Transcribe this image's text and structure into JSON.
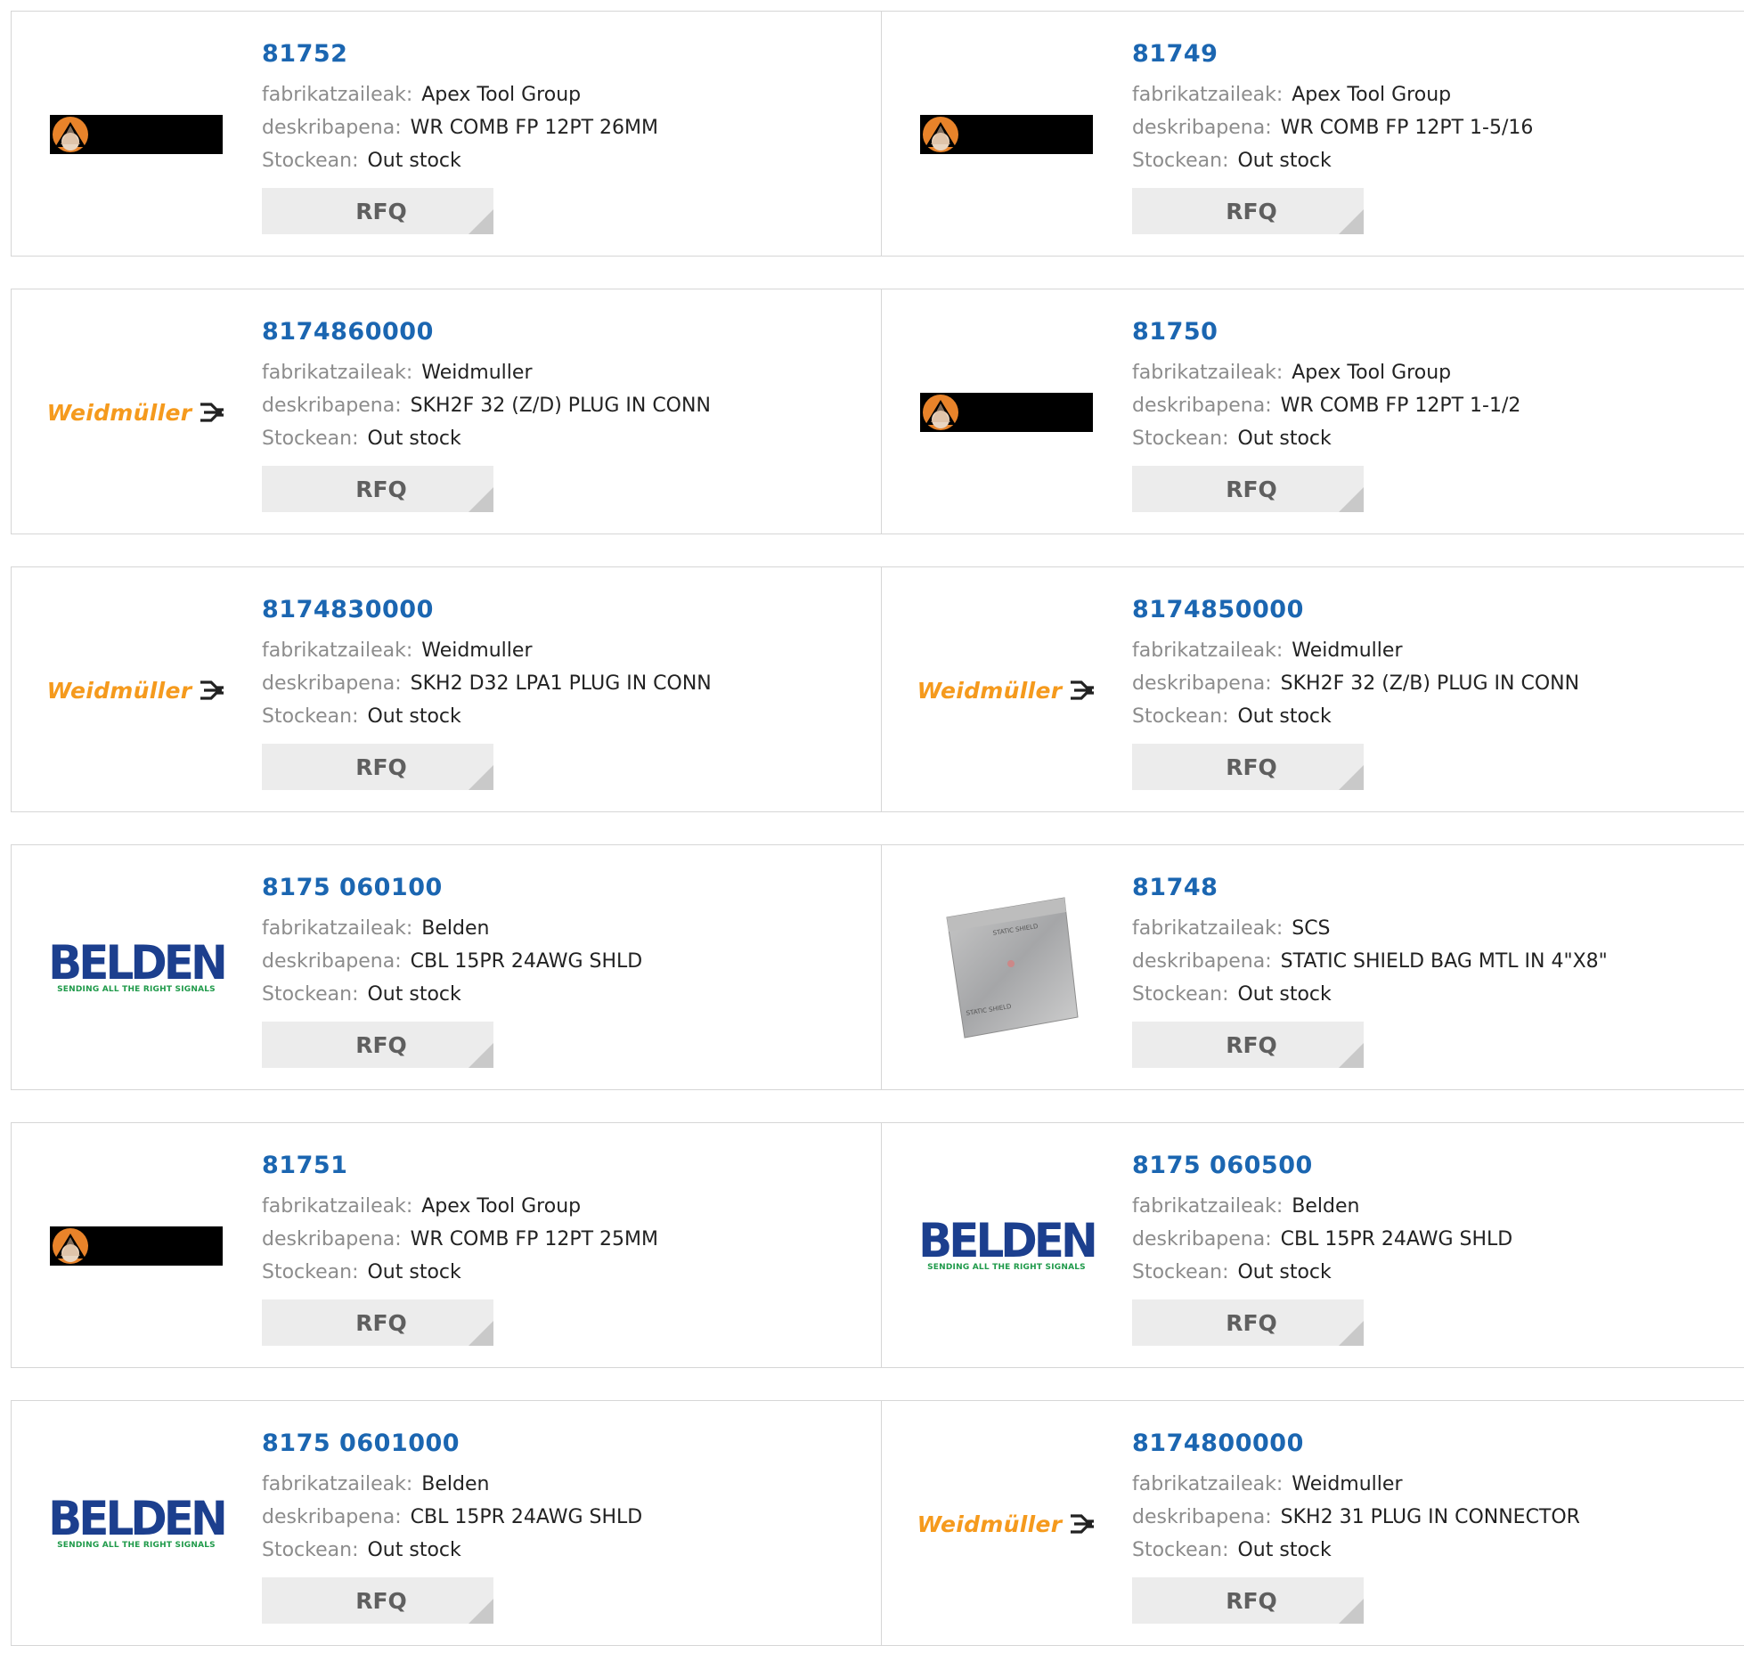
{
  "labels": {
    "manufacturer": "fabrikatzaileak:",
    "description": "deskribapena:",
    "stock": "Stockean:",
    "rfq": "RFQ"
  },
  "products": [
    {
      "part": "81752",
      "manufacturer": "Apex Tool Group",
      "description": "WR COMB FP 12PT 26MM",
      "stock": "Out stock",
      "logo": "apex"
    },
    {
      "part": "81749",
      "manufacturer": "Apex Tool Group",
      "description": "WR COMB FP 12PT 1-5/16",
      "stock": "Out stock",
      "logo": "apex"
    },
    {
      "part": "8174860000",
      "manufacturer": "Weidmuller",
      "description": "SKH2F 32 (Z/D) PLUG IN CONN",
      "stock": "Out stock",
      "logo": "weidmuller"
    },
    {
      "part": "81750",
      "manufacturer": "Apex Tool Group",
      "description": "WR COMB FP 12PT 1-1/2",
      "stock": "Out stock",
      "logo": "apex"
    },
    {
      "part": "8174830000",
      "manufacturer": "Weidmuller",
      "description": "SKH2 D32 LPA1 PLUG IN CONN",
      "stock": "Out stock",
      "logo": "weidmuller"
    },
    {
      "part": "8174850000",
      "manufacturer": "Weidmuller",
      "description": "SKH2F 32 (Z/B) PLUG IN CONN",
      "stock": "Out stock",
      "logo": "weidmuller"
    },
    {
      "part": "8175 060100",
      "manufacturer": "Belden",
      "description": "CBL 15PR 24AWG SHLD",
      "stock": "Out stock",
      "logo": "belden"
    },
    {
      "part": "81748",
      "manufacturer": "SCS",
      "description": "STATIC SHIELD BAG MTL IN 4\"X8\"",
      "stock": "Out stock",
      "logo": "static-bag"
    },
    {
      "part": "81751",
      "manufacturer": "Apex Tool Group",
      "description": "WR COMB FP 12PT 25MM",
      "stock": "Out stock",
      "logo": "apex"
    },
    {
      "part": "8175 060500",
      "manufacturer": "Belden",
      "description": "CBL 15PR 24AWG SHLD",
      "stock": "Out stock",
      "logo": "belden"
    },
    {
      "part": "8175 0601000",
      "manufacturer": "Belden",
      "description": "CBL 15PR 24AWG SHLD",
      "stock": "Out stock",
      "logo": "belden"
    },
    {
      "part": "8174800000",
      "manufacturer": "Weidmuller",
      "description": "SKH2 31 PLUG IN CONNECTOR",
      "stock": "Out stock",
      "logo": "weidmuller"
    }
  ],
  "logos": {
    "weidmuller_text": "Weidmüller",
    "belden_text": "BELDEN",
    "belden_tagline": "SENDING ALL THE RIGHT SIGNALS",
    "bag_text": "STATIC SHIELD"
  },
  "colors": {
    "part_link": "#1b66b1",
    "label": "#8c8c8c",
    "weidmuller_orange": "#f59a1d",
    "belden_blue": "#1c3f8e",
    "belden_green": "#1f9a4a",
    "rfq_bg": "#ececec"
  }
}
